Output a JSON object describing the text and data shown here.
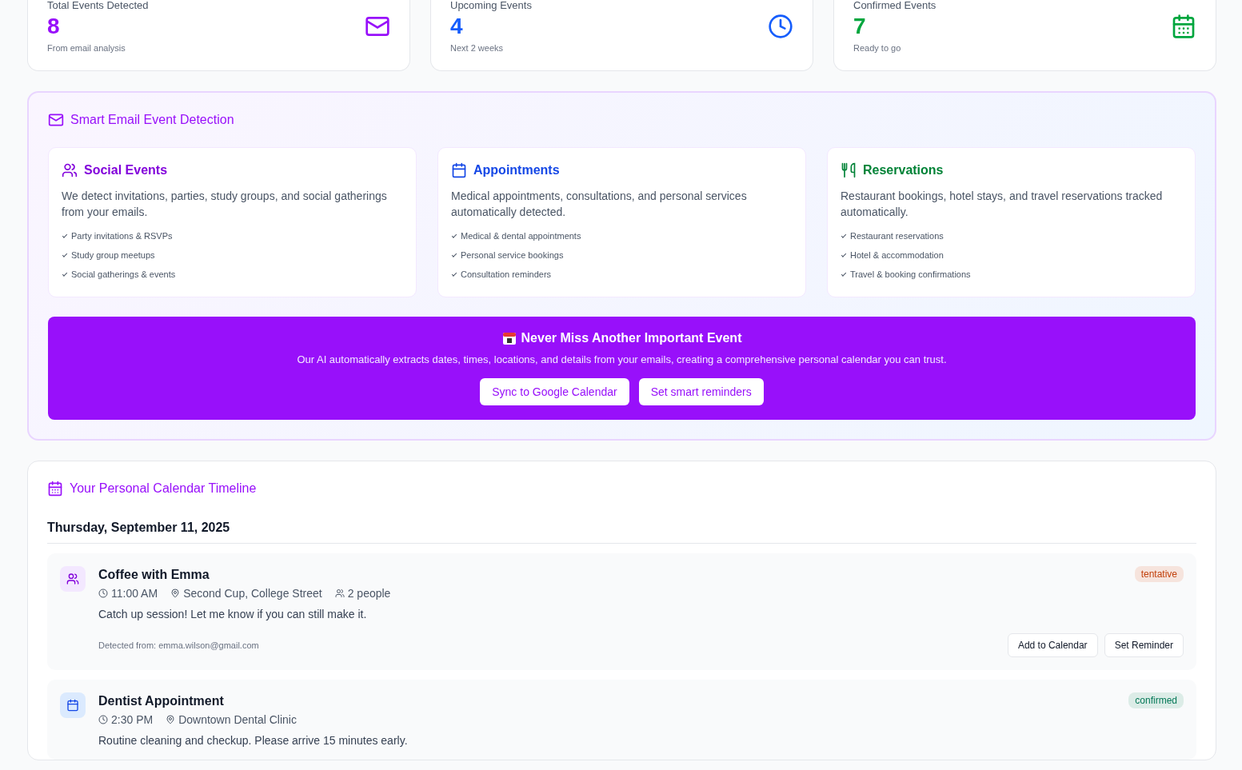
{
  "stats": [
    {
      "label": "Total Events Detected",
      "value": "8",
      "note": "From email analysis",
      "kind": "mail",
      "color": "#9810fa"
    },
    {
      "label": "Upcoming Events",
      "value": "4",
      "note": "Next 2 weeks",
      "kind": "clock",
      "color": "#155dfc"
    },
    {
      "label": "Confirmed Events",
      "value": "7",
      "note": "Ready to go",
      "kind": "calendar",
      "color": "#00a63e"
    }
  ],
  "detection": {
    "title": "Smart Email Event Detection",
    "cards": [
      {
        "kind": "social",
        "title": "Social Events",
        "color": "#8200db",
        "description": "We detect invitations, parties, study groups, and social gatherings from your emails.",
        "features": [
          "Party invitations & RSVPs",
          "Study group meetups",
          "Social gatherings & events"
        ]
      },
      {
        "kind": "appointment",
        "title": "Appointments",
        "color": "#1447e6",
        "description": "Medical appointments, consultations, and personal services automatically detected.",
        "features": [
          "Medical & dental appointments",
          "Personal service bookings",
          "Consultation reminders"
        ]
      },
      {
        "kind": "reservation",
        "title": "Reservations",
        "color": "#008236",
        "description": "Restaurant bookings, hotel stays, and travel reservations tracked automatically.",
        "features": [
          "Restaurant reservations",
          "Hotel & accommodation",
          "Travel & booking confirmations"
        ]
      }
    ],
    "banner": {
      "title": "Never Miss Another Important Event",
      "text": "Our AI automatically extracts dates, times, locations, and details from your emails, creating a comprehensive personal calendar you can trust.",
      "buttons": [
        "Sync to Google Calendar",
        "Set smart reminders"
      ]
    }
  },
  "timeline": {
    "title": "Your Personal Calendar Timeline",
    "date": "Thursday, September 11, 2025",
    "events": [
      {
        "kind": "social",
        "title": "Coffee with Emma",
        "time": "11:00 AM",
        "location": "Second Cup, College Street",
        "people": "2 people",
        "description": "Catch up session! Let me know if you can still make it.",
        "detected_from": "Detected from: emma.wilson@gmail.com",
        "status": {
          "label": "tentative",
          "color": "#c2410c"
        },
        "buttons": [
          "Add to Calendar",
          "Set Reminder"
        ]
      },
      {
        "kind": "appointment",
        "title": "Dentist Appointment",
        "time": "2:30 PM",
        "location": "Downtown Dental Clinic",
        "description": "Routine cleaning and checkup. Please arrive 15 minutes early.",
        "status": {
          "label": "confirmed",
          "color": "#047857"
        }
      }
    ]
  }
}
